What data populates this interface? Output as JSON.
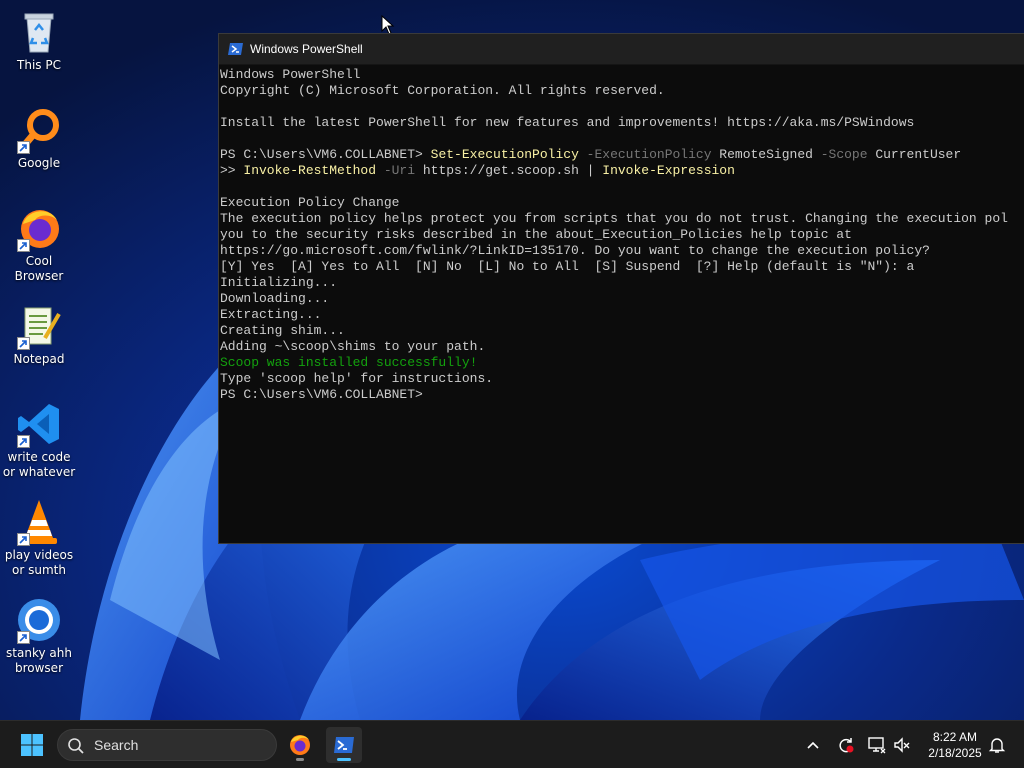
{
  "desktop": {
    "icons": [
      {
        "label": "This PC",
        "icon": "recycle-bin-icon"
      },
      {
        "label": "Google",
        "icon": "magnifier-icon"
      },
      {
        "label": "Cool Browser",
        "icon": "firefox-icon"
      },
      {
        "label": "Notepad",
        "icon": "notepad-icon"
      },
      {
        "label": "write code or whatever",
        "icon": "vscode-icon"
      },
      {
        "label": "play videos or sumth",
        "icon": "vlc-icon"
      },
      {
        "label": "stanky ahh browser",
        "icon": "chrome-icon"
      }
    ]
  },
  "window": {
    "title": "Windows PowerShell",
    "console": {
      "header1": "Windows PowerShell",
      "header2": "Copyright (C) Microsoft Corporation. All rights reserved.",
      "install_msg": "Install the latest PowerShell for new features and improvements! https://aka.ms/PSWindows",
      "prompt1": "PS C:\\Users\\VM6.COLLABNET> ",
      "cmd1": "Set-ExecutionPolicy",
      "p1": " -ExecutionPolicy",
      "v1": " RemoteSigned",
      "p2": " -Scope",
      "v2": " CurrentUser",
      "cont": ">> ",
      "cmd2": "Invoke-RestMethod",
      "p3": " -Uri",
      "v3": " https://get.scoop.sh | ",
      "cmd3": "Invoke-Expression",
      "policy_title": "Execution Policy Change",
      "policy1": "The execution policy helps protect you from scripts that you do not trust. Changing the execution pol",
      "policy2": "you to the security risks described in the about_Execution_Policies help topic at",
      "policy3": "https://go.microsoft.com/fwlink/?LinkID=135170. Do you want to change the execution policy?",
      "policy4": "[Y] Yes  [A] Yes to All  [N] No  [L] No to All  [S] Suspend  [?] Help (default is \"N\"): a",
      "out1": "Initializing...",
      "out2": "Downloading...",
      "out3": "Extracting...",
      "out4": "Creating shim...",
      "out5": "Adding ~\\scoop\\shims to your path.",
      "success": "Scoop was installed successfully!",
      "out6": "Type 'scoop help' for instructions.",
      "prompt2": "PS C:\\Users\\VM6.COLLABNET>"
    }
  },
  "taskbar": {
    "search_placeholder": "Search",
    "apps": [
      "firefox-icon",
      "powershell-icon"
    ],
    "time": "8:22 AM",
    "date": "2/18/2025"
  },
  "colors": {
    "console_bg": "#0c0c0c",
    "command": "#f9f1a5",
    "parameter": "#767676",
    "success": "#13a10e",
    "accent": "#4cc2ff"
  }
}
